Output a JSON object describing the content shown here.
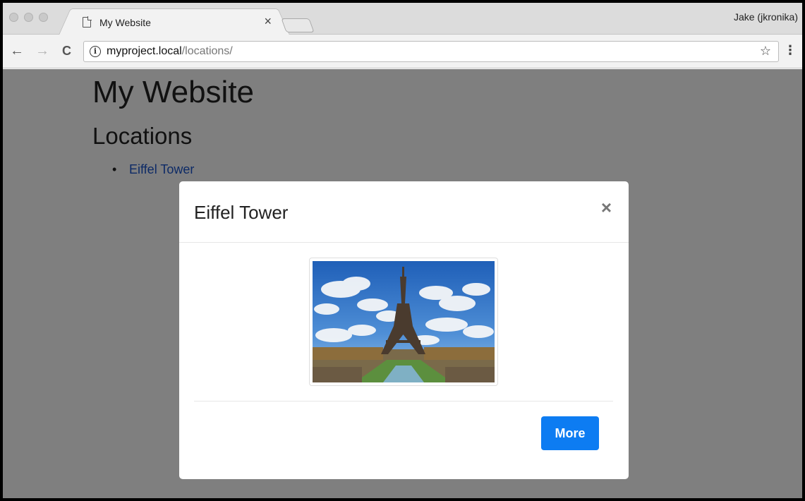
{
  "browser": {
    "tab_title": "My Website",
    "tab_close": "×",
    "profile_name": "Jake (jkronika)",
    "url_host": "myproject.local",
    "url_path": "/locations/",
    "back_glyph": "←",
    "forward_glyph": "→",
    "reload_glyph": "C",
    "bookmark_glyph": "☆",
    "menu_glyph": "⋮",
    "info_glyph": "i"
  },
  "page": {
    "site_title": "My Website",
    "section_title": "Locations",
    "locations": [
      {
        "label": "Eiffel Tower"
      }
    ]
  },
  "modal": {
    "title": "Eiffel Tower",
    "close_glyph": "×",
    "image_subject": "eiffel-tower-photo",
    "more_label": "More"
  },
  "colors": {
    "link": "#1a55cc",
    "primary_button": "#0d7cf2",
    "backdrop": "rgba(0,0,0,0.5)"
  }
}
